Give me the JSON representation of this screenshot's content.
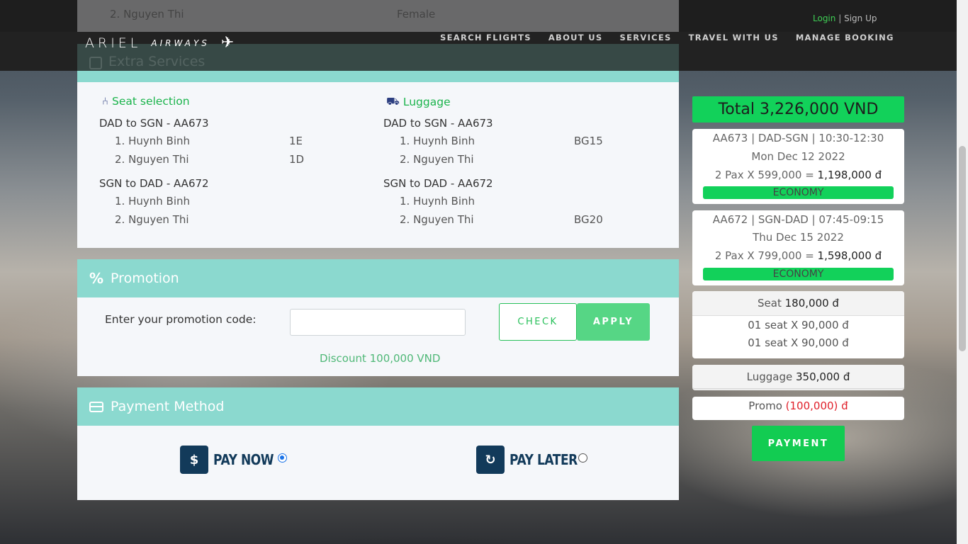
{
  "brand": {
    "name": "ARIEL",
    "sub": "AIRWAYS"
  },
  "auth": {
    "login": "Login",
    "separator": "|",
    "signup": "Sign Up"
  },
  "nav": [
    "SEARCH FLIGHTS",
    "ABOUT US",
    "SERVICES",
    "TRAVEL WITH US",
    "MANAGE BOOKING"
  ],
  "prev_row": {
    "name": "2. Nguyen Thi",
    "gender": "Female"
  },
  "extra_services": {
    "title": "Extra Services",
    "seat": {
      "title": "Seat selection",
      "segments": [
        {
          "route": "DAD to SGN - AA673",
          "pax": [
            {
              "name": "1. Huynh Binh",
              "value": "1E"
            },
            {
              "name": "2. Nguyen Thi",
              "value": "1D"
            }
          ]
        },
        {
          "route": "SGN to DAD - AA672",
          "pax": [
            {
              "name": "1. Huynh Binh",
              "value": ""
            },
            {
              "name": "2. Nguyen Thi",
              "value": ""
            }
          ]
        }
      ]
    },
    "luggage": {
      "title": "Luggage",
      "segments": [
        {
          "route": "DAD to SGN - AA673",
          "pax": [
            {
              "name": "1. Huynh Binh",
              "value": "BG15"
            },
            {
              "name": "2. Nguyen Thi",
              "value": ""
            }
          ]
        },
        {
          "route": "SGN to DAD - AA672",
          "pax": [
            {
              "name": "1. Huynh Binh",
              "value": ""
            },
            {
              "name": "2. Nguyen Thi",
              "value": "BG20"
            }
          ]
        }
      ]
    }
  },
  "promotion": {
    "title": "Promotion",
    "label": "Enter your promotion code:",
    "input_value": "",
    "check": "CHECK",
    "apply": "APPLY",
    "discount": "Discount 100,000 VND"
  },
  "payment_method": {
    "title": "Payment Method",
    "pay_now": "PAY NOW",
    "pay_later": "PAY LATER",
    "selected": "pay_now"
  },
  "summary": {
    "total": "Total 3,226,000 VND",
    "flights": [
      {
        "line1": "AA673 | DAD-SGN | 10:30-12:30",
        "date": "Mon Dec 12 2022",
        "price_prefix": "2 Pax X 599,000 = ",
        "price_total": "1,198,000 đ",
        "class": "ECONOMY"
      },
      {
        "line1": "AA672 | SGN-DAD | 07:45-09:15",
        "date": "Thu Dec 15 2022",
        "price_prefix": "2 Pax X 799,000 = ",
        "price_total": "1,598,000 đ",
        "class": "ECONOMY"
      }
    ],
    "seat": {
      "label": "Seat ",
      "amount": "180,000 đ",
      "lines": [
        "01 seat X 90,000 đ",
        "01 seat X 90,000 đ"
      ]
    },
    "luggage": {
      "label": "Luggage ",
      "amount": "350,000 đ"
    },
    "promo": {
      "label": "Promo ",
      "amount": "(100,000) đ"
    },
    "payment_button": "PAYMENT"
  },
  "colors": {
    "accent": "#12d15a",
    "panel_head": "#8bd9cf",
    "navy": "#123a5a",
    "promo_red": "#e0202a"
  }
}
